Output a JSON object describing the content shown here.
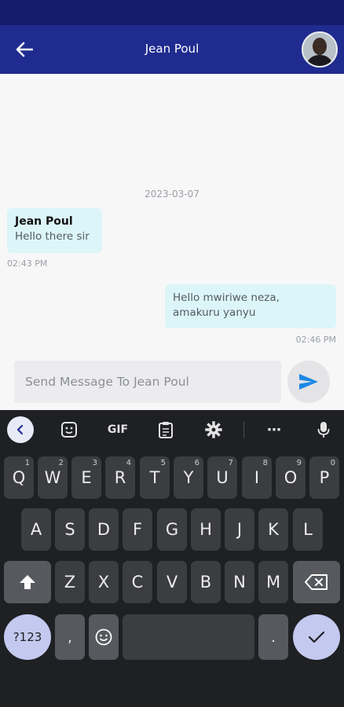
{
  "app_bar": {
    "title": "Jean Poul",
    "back_label": "back",
    "bg_color": "#1f2b8f"
  },
  "chat": {
    "date_separator": "2023-03-07",
    "messages": [
      {
        "direction": "incoming",
        "sender": "Jean Poul",
        "text": "Hello there sir",
        "time": "02:43 PM"
      },
      {
        "direction": "outgoing",
        "text_line1": "Hello mwiriwe neza,",
        "text_line2": "amakuru yanyu",
        "time": "02:46 PM"
      }
    ]
  },
  "composer": {
    "placeholder": "Send Message To Jean Poul",
    "value": "",
    "send_icon": "send-icon",
    "accent_color": "#1e88e5"
  },
  "keyboard": {
    "toolbar": {
      "gif_label": "GIF",
      "more_label": "⋯"
    },
    "row1": [
      {
        "label": "Q",
        "hint": "1"
      },
      {
        "label": "W",
        "hint": "2"
      },
      {
        "label": "E",
        "hint": "3"
      },
      {
        "label": "R",
        "hint": "4"
      },
      {
        "label": "T",
        "hint": "5"
      },
      {
        "label": "Y",
        "hint": "6"
      },
      {
        "label": "U",
        "hint": "7"
      },
      {
        "label": "I",
        "hint": "8"
      },
      {
        "label": "O",
        "hint": "9"
      },
      {
        "label": "P",
        "hint": "0"
      }
    ],
    "row2": [
      "A",
      "S",
      "D",
      "F",
      "G",
      "H",
      "J",
      "K",
      "L"
    ],
    "row3": [
      "Z",
      "X",
      "C",
      "V",
      "B",
      "N",
      "M"
    ],
    "symbols_label": "?123",
    "comma_label": ",",
    "period_label": "."
  }
}
